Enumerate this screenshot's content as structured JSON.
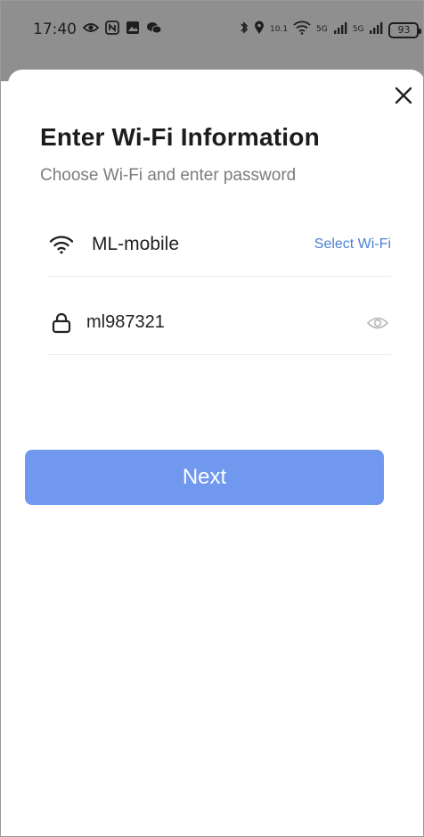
{
  "status_bar": {
    "time": "17:40",
    "signal_label": "5G",
    "network_speed": "10.1",
    "battery_level": "93"
  },
  "dialog": {
    "title": "Enter Wi-Fi Information",
    "subtitle": "Choose Wi-Fi and enter password"
  },
  "wifi": {
    "ssid": "ML-mobile",
    "select_label": "Select Wi-Fi",
    "icon": "wifi-icon"
  },
  "password": {
    "value": "ml987321",
    "lock_icon": "lock-icon",
    "visibility_icon": "eye-icon"
  },
  "actions": {
    "next_label": "Next",
    "next_color": "#6f98ee",
    "link_color": "#4a7fd6"
  }
}
